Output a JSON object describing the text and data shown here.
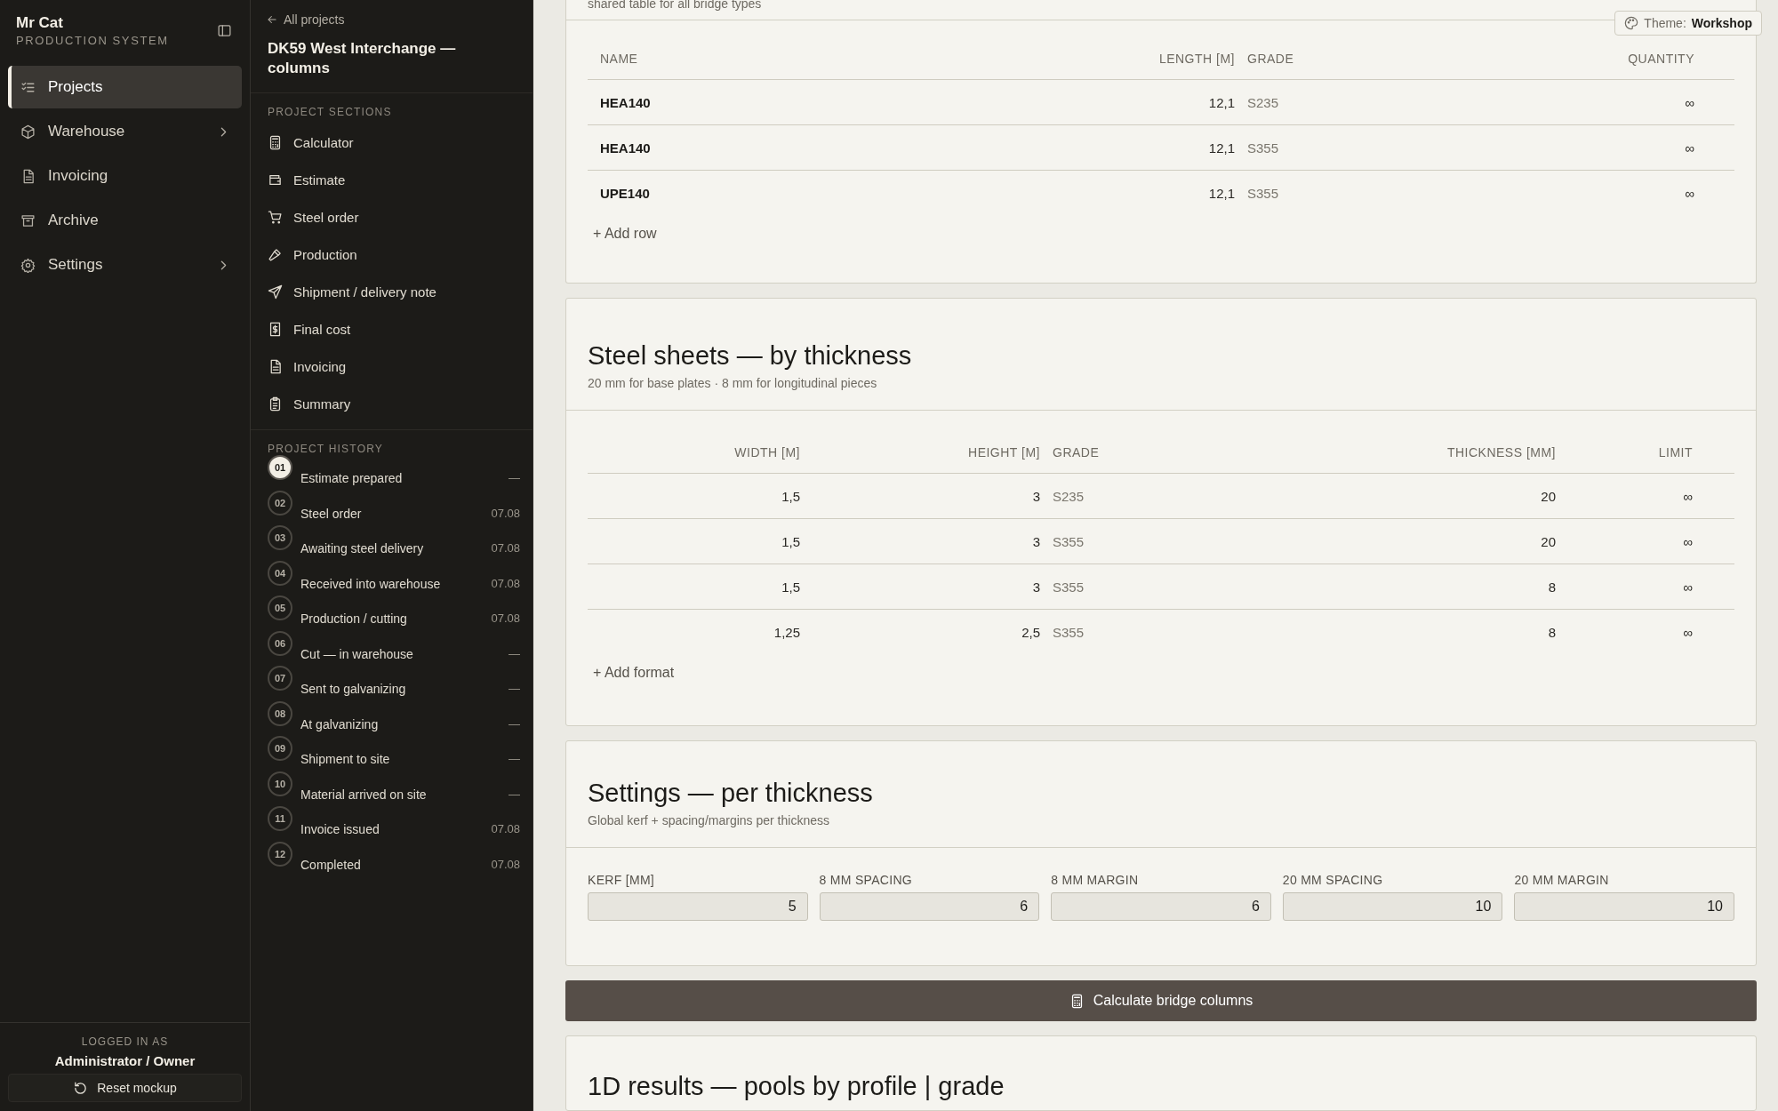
{
  "brand": {
    "name": "Mr Cat",
    "subtitle": "PRODUCTION SYSTEM"
  },
  "nav": [
    {
      "label": "Projects",
      "selected": true,
      "has_submenu": false
    },
    {
      "label": "Warehouse",
      "selected": false,
      "has_submenu": true
    },
    {
      "label": "Invoicing",
      "selected": false,
      "has_submenu": false
    },
    {
      "label": "Archive",
      "selected": false,
      "has_submenu": false
    },
    {
      "label": "Settings",
      "selected": false,
      "has_submenu": true
    }
  ],
  "user": {
    "caption": "LOGGED IN AS",
    "role": "Administrator / Owner",
    "reset_button": "Reset mockup"
  },
  "project": {
    "back_link": "All projects",
    "title": "DK59 West Interchange — columns",
    "sections_heading": "PROJECT SECTIONS",
    "sections": [
      "Calculator",
      "Estimate",
      "Steel order",
      "Production",
      "Shipment / delivery note",
      "Final cost",
      "Invoicing",
      "Summary"
    ],
    "history_heading": "PROJECT HISTORY",
    "history": [
      {
        "number": "01",
        "label": "Estimate prepared",
        "date": "—",
        "current": true
      },
      {
        "number": "02",
        "label": "Steel order",
        "date": "07.08",
        "current": false
      },
      {
        "number": "03",
        "label": "Awaiting steel delivery",
        "date": "07.08",
        "current": false
      },
      {
        "number": "04",
        "label": "Received into warehouse",
        "date": "07.08",
        "current": false
      },
      {
        "number": "05",
        "label": "Production / cutting",
        "date": "07.08",
        "current": false
      },
      {
        "number": "06",
        "label": "Cut — in warehouse",
        "date": "—",
        "current": false
      },
      {
        "number": "07",
        "label": "Sent to galvanizing",
        "date": "—",
        "current": false
      },
      {
        "number": "08",
        "label": "At galvanizing",
        "date": "—",
        "current": false
      },
      {
        "number": "09",
        "label": "Shipment to site",
        "date": "—",
        "current": false
      },
      {
        "number": "10",
        "label": "Material arrived on site",
        "date": "—",
        "current": false
      },
      {
        "number": "11",
        "label": "Invoice issued",
        "date": "07.08",
        "current": false
      },
      {
        "number": "12",
        "label": "Completed",
        "date": "07.08",
        "current": false
      }
    ]
  },
  "theme_badge": {
    "label": "Theme:",
    "value": "Workshop"
  },
  "profiles": {
    "subtitle": "shared table for all bridge types",
    "columns": [
      "NAME",
      "LENGTH [M]",
      "GRADE",
      "QUANTITY"
    ],
    "rows": [
      [
        "HEA140",
        "12,1",
        "S235",
        "∞"
      ],
      [
        "HEA140",
        "12,1",
        "S355",
        "∞"
      ],
      [
        "UPE140",
        "12,1",
        "S355",
        "∞"
      ]
    ],
    "add_button": "+ Add row"
  },
  "sheets": {
    "title": "Steel sheets — by thickness",
    "subtitle": "20 mm for base plates · 8 mm for longitudinal pieces",
    "columns": [
      "WIDTH [M]",
      "HEIGHT [M]",
      "GRADE",
      "THICKNESS [MM]",
      "LIMIT"
    ],
    "rows": [
      [
        "1,5",
        "3",
        "S235",
        "20",
        "∞"
      ],
      [
        "1,5",
        "3",
        "S355",
        "20",
        "∞"
      ],
      [
        "1,5",
        "3",
        "S355",
        "8",
        "∞"
      ],
      [
        "1,25",
        "2,5",
        "S355",
        "8",
        "∞"
      ]
    ],
    "add_button": "+ Add format"
  },
  "settings": {
    "title": "Settings — per thickness",
    "subtitle": "Global kerf + spacing/margins per thickness",
    "fields": [
      {
        "label": "KERF [MM]",
        "value": "5"
      },
      {
        "label": "8 MM SPACING",
        "value": "6"
      },
      {
        "label": "8 MM MARGIN",
        "value": "6"
      },
      {
        "label": "20 MM SPACING",
        "value": "10"
      },
      {
        "label": "20 MM MARGIN",
        "value": "10"
      }
    ]
  },
  "calculate_button": "Calculate bridge columns",
  "results": {
    "title": "1D results — pools by profile | grade"
  }
}
